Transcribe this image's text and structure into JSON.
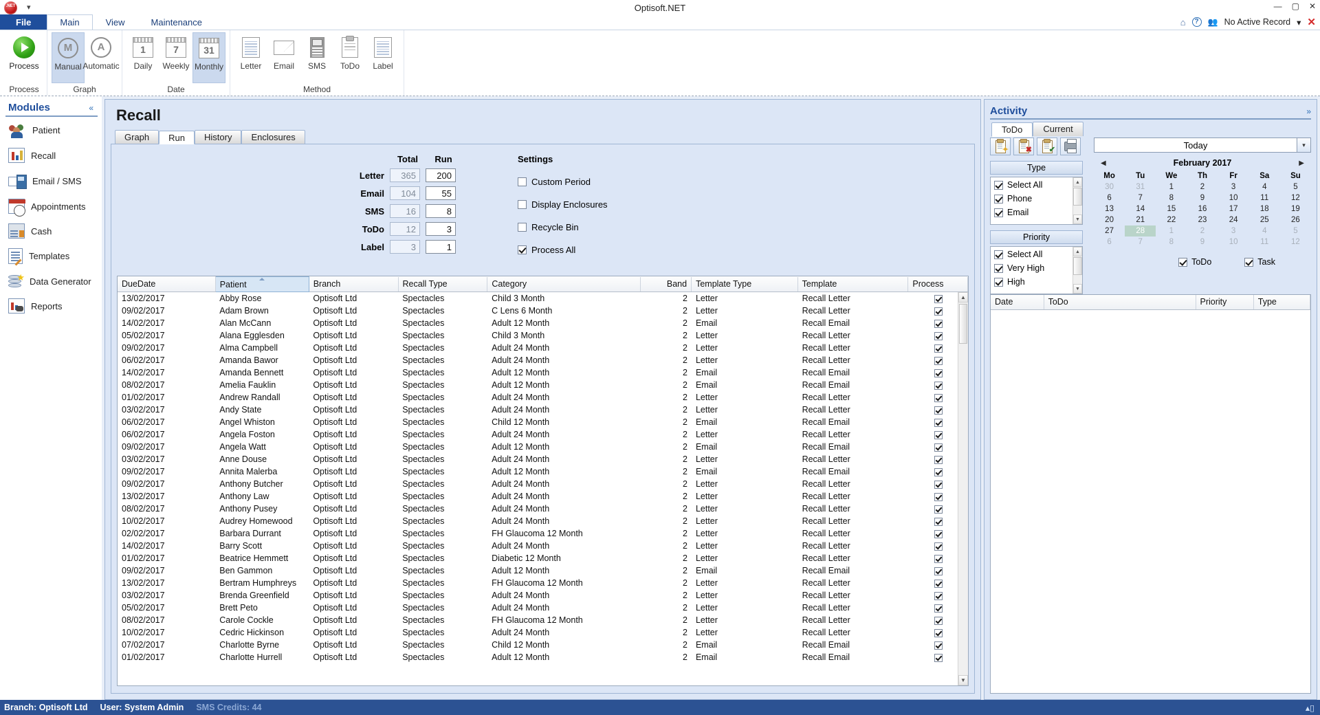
{
  "window": {
    "title": "Optisoft.NET",
    "minimize": "—",
    "maximize": "▢",
    "close": "✕",
    "qat_arrow": "▾"
  },
  "ribbon": {
    "tabs": [
      {
        "label": "File",
        "active": false,
        "kind": "file"
      },
      {
        "label": "Main",
        "active": true,
        "kind": "normal"
      },
      {
        "label": "View",
        "active": false,
        "kind": "normal"
      },
      {
        "label": "Maintenance",
        "active": false,
        "kind": "normal"
      }
    ],
    "right": {
      "record_label": "No Active Record",
      "record_caret": "▾",
      "help_glyph": "?",
      "home_glyph": "⌂",
      "close_glyph": "✕"
    },
    "groups": [
      {
        "label": "Process",
        "buttons": [
          {
            "label": "Process",
            "icon": "play-circle-icon",
            "selected": false,
            "enabled": true
          }
        ]
      },
      {
        "label": "Graph",
        "buttons": [
          {
            "label": "Manual",
            "icon": "manual-circle-icon",
            "selected": true,
            "enabled": false,
            "glyph": "M"
          },
          {
            "label": "Automatic",
            "icon": "automatic-circle-icon",
            "selected": false,
            "enabled": false,
            "glyph": "A"
          }
        ]
      },
      {
        "label": "Date",
        "buttons": [
          {
            "label": "Daily",
            "icon": "calendar-day-icon",
            "selected": false,
            "enabled": false,
            "glyph": "1"
          },
          {
            "label": "Weekly",
            "icon": "calendar-week-icon",
            "selected": false,
            "enabled": false,
            "glyph": "7"
          },
          {
            "label": "Monthly",
            "icon": "calendar-month-icon",
            "selected": true,
            "enabled": false,
            "glyph": "31"
          }
        ]
      },
      {
        "label": "Method",
        "buttons": [
          {
            "label": "Letter",
            "icon": "letter-icon",
            "selected": false,
            "enabled": false
          },
          {
            "label": "Email",
            "icon": "envelope-icon",
            "selected": false,
            "enabled": false
          },
          {
            "label": "SMS",
            "icon": "mobile-phone-icon",
            "selected": false,
            "enabled": false
          },
          {
            "label": "ToDo",
            "icon": "clipboard-icon",
            "selected": false,
            "enabled": false
          },
          {
            "label": "Label",
            "icon": "label-icon",
            "selected": false,
            "enabled": false
          }
        ]
      }
    ]
  },
  "sidebar": {
    "title": "Modules",
    "collapse_glyph": "«",
    "items": [
      {
        "label": "Patient",
        "icon": "patients-icon"
      },
      {
        "label": "Recall",
        "icon": "recall-chart-icon"
      },
      {
        "label": "Email / SMS",
        "icon": "email-sms-icon"
      },
      {
        "label": "Appointments",
        "icon": "appointments-icon"
      },
      {
        "label": "Cash",
        "icon": "cash-register-icon"
      },
      {
        "label": "Templates",
        "icon": "templates-icon"
      },
      {
        "label": "Data Generator",
        "icon": "data-generator-icon"
      },
      {
        "label": "Reports",
        "icon": "reports-icon"
      }
    ]
  },
  "main": {
    "title": "Recall",
    "tabs": [
      {
        "label": "Graph",
        "active": false
      },
      {
        "label": "Run",
        "active": true
      },
      {
        "label": "History",
        "active": false
      },
      {
        "label": "Enclosures",
        "active": false
      }
    ],
    "counts": {
      "header_total": "Total",
      "header_run": "Run",
      "rows": [
        {
          "label": "Letter",
          "total": "365",
          "run": "200"
        },
        {
          "label": "Email",
          "total": "104",
          "run": "55"
        },
        {
          "label": "SMS",
          "total": "16",
          "run": "8"
        },
        {
          "label": "ToDo",
          "total": "12",
          "run": "3"
        },
        {
          "label": "Label",
          "total": "3",
          "run": "1"
        }
      ]
    },
    "settings": {
      "title": "Settings",
      "options": [
        {
          "label": "Custom Period",
          "checked": false
        },
        {
          "label": "Display Enclosures",
          "checked": false
        },
        {
          "label": "Recycle Bin",
          "checked": false
        },
        {
          "label": "Process All",
          "checked": true
        }
      ]
    },
    "grid": {
      "columns": [
        {
          "label": "DueDate",
          "align": "left",
          "sorted": false
        },
        {
          "label": "Patient",
          "align": "left",
          "sorted": true
        },
        {
          "label": "Branch",
          "align": "left",
          "sorted": false
        },
        {
          "label": "Recall Type",
          "align": "left",
          "sorted": false
        },
        {
          "label": "Category",
          "align": "left",
          "sorted": false
        },
        {
          "label": "Band",
          "align": "right",
          "sorted": false
        },
        {
          "label": "Template Type",
          "align": "left",
          "sorted": false
        },
        {
          "label": "Template",
          "align": "left",
          "sorted": false
        },
        {
          "label": "Process",
          "align": "left",
          "sorted": false
        }
      ],
      "rows": [
        [
          "13/02/2017",
          "Abby Rose",
          "Optisoft Ltd",
          "Spectacles",
          "Child 3 Month",
          "2",
          "Letter",
          "Recall Letter",
          true
        ],
        [
          "09/02/2017",
          "Adam Brown",
          "Optisoft Ltd",
          "Spectacles",
          "C Lens 6 Month",
          "2",
          "Letter",
          "Recall Letter",
          true
        ],
        [
          "14/02/2017",
          "Alan McCann",
          "Optisoft Ltd",
          "Spectacles",
          "Adult 12 Month",
          "2",
          "Email",
          "Recall Email",
          true
        ],
        [
          "05/02/2017",
          "Alana Egglesden",
          "Optisoft Ltd",
          "Spectacles",
          "Child 3 Month",
          "2",
          "Letter",
          "Recall Letter",
          true
        ],
        [
          "09/02/2017",
          "Alma Campbell",
          "Optisoft Ltd",
          "Spectacles",
          "Adult 24 Month",
          "2",
          "Letter",
          "Recall Letter",
          true
        ],
        [
          "06/02/2017",
          "Amanda Bawor",
          "Optisoft Ltd",
          "Spectacles",
          "Adult 24 Month",
          "2",
          "Letter",
          "Recall Letter",
          true
        ],
        [
          "14/02/2017",
          "Amanda Bennett",
          "Optisoft Ltd",
          "Spectacles",
          "Adult 12 Month",
          "2",
          "Email",
          "Recall Email",
          true
        ],
        [
          "08/02/2017",
          "Amelia Fauklin",
          "Optisoft Ltd",
          "Spectacles",
          "Adult 12 Month",
          "2",
          "Email",
          "Recall Email",
          true
        ],
        [
          "01/02/2017",
          "Andrew Randall",
          "Optisoft Ltd",
          "Spectacles",
          "Adult 24 Month",
          "2",
          "Letter",
          "Recall Letter",
          true
        ],
        [
          "03/02/2017",
          "Andy State",
          "Optisoft Ltd",
          "Spectacles",
          "Adult 24 Month",
          "2",
          "Letter",
          "Recall Letter",
          true
        ],
        [
          "06/02/2017",
          "Angel Whiston",
          "Optisoft Ltd",
          "Spectacles",
          "Child 12 Month",
          "2",
          "Email",
          "Recall Email",
          true
        ],
        [
          "06/02/2017",
          "Angela Foston",
          "Optisoft Ltd",
          "Spectacles",
          "Adult 24 Month",
          "2",
          "Letter",
          "Recall Letter",
          true
        ],
        [
          "09/02/2017",
          "Angela Watt",
          "Optisoft Ltd",
          "Spectacles",
          "Adult 12 Month",
          "2",
          "Email",
          "Recall Email",
          true
        ],
        [
          "03/02/2017",
          "Anne Douse",
          "Optisoft Ltd",
          "Spectacles",
          "Adult 24 Month",
          "2",
          "Letter",
          "Recall Letter",
          true
        ],
        [
          "09/02/2017",
          "Annita Malerba",
          "Optisoft Ltd",
          "Spectacles",
          "Adult 12 Month",
          "2",
          "Email",
          "Recall Email",
          true
        ],
        [
          "09/02/2017",
          "Anthony Butcher",
          "Optisoft Ltd",
          "Spectacles",
          "Adult 24 Month",
          "2",
          "Letter",
          "Recall Letter",
          true
        ],
        [
          "13/02/2017",
          "Anthony Law",
          "Optisoft Ltd",
          "Spectacles",
          "Adult 24 Month",
          "2",
          "Letter",
          "Recall Letter",
          true
        ],
        [
          "08/02/2017",
          "Anthony Pusey",
          "Optisoft Ltd",
          "Spectacles",
          "Adult 24 Month",
          "2",
          "Letter",
          "Recall Letter",
          true
        ],
        [
          "10/02/2017",
          "Audrey Homewood",
          "Optisoft Ltd",
          "Spectacles",
          "Adult 24 Month",
          "2",
          "Letter",
          "Recall Letter",
          true
        ],
        [
          "02/02/2017",
          "Barbara Durrant",
          "Optisoft Ltd",
          "Spectacles",
          "FH Glaucoma 12 Month",
          "2",
          "Letter",
          "Recall Letter",
          true
        ],
        [
          "14/02/2017",
          "Barry Scott",
          "Optisoft Ltd",
          "Spectacles",
          "Adult 24 Month",
          "2",
          "Letter",
          "Recall Letter",
          true
        ],
        [
          "01/02/2017",
          "Beatrice Hemmett",
          "Optisoft Ltd",
          "Spectacles",
          "Diabetic 12 Month",
          "2",
          "Letter",
          "Recall Letter",
          true
        ],
        [
          "09/02/2017",
          "Ben Gammon",
          "Optisoft Ltd",
          "Spectacles",
          "Adult 12 Month",
          "2",
          "Email",
          "Recall Email",
          true
        ],
        [
          "13/02/2017",
          "Bertram Humphreys",
          "Optisoft Ltd",
          "Spectacles",
          "FH Glaucoma 12 Month",
          "2",
          "Letter",
          "Recall Letter",
          true
        ],
        [
          "03/02/2017",
          "Brenda Greenfield",
          "Optisoft Ltd",
          "Spectacles",
          "Adult 24 Month",
          "2",
          "Letter",
          "Recall Letter",
          true
        ],
        [
          "05/02/2017",
          "Brett Peto",
          "Optisoft Ltd",
          "Spectacles",
          "Adult 24 Month",
          "2",
          "Letter",
          "Recall Letter",
          true
        ],
        [
          "08/02/2017",
          "Carole Cockle",
          "Optisoft Ltd",
          "Spectacles",
          "FH Glaucoma 12 Month",
          "2",
          "Letter",
          "Recall Letter",
          true
        ],
        [
          "10/02/2017",
          "Cedric Hickinson",
          "Optisoft Ltd",
          "Spectacles",
          "Adult 24 Month",
          "2",
          "Letter",
          "Recall Letter",
          true
        ],
        [
          "07/02/2017",
          "Charlotte Byrne",
          "Optisoft Ltd",
          "Spectacles",
          "Child 12 Month",
          "2",
          "Email",
          "Recall Email",
          true
        ],
        [
          "01/02/2017",
          "Charlotte Hurrell",
          "Optisoft Ltd",
          "Spectacles",
          "Adult 12 Month",
          "2",
          "Email",
          "Recall Email",
          true
        ]
      ]
    }
  },
  "activity": {
    "title": "Activity",
    "expand_glyph": "»",
    "tabs": [
      {
        "label": "ToDo",
        "active": true
      },
      {
        "label": "Current",
        "active": false
      }
    ],
    "toolbar": [
      {
        "name": "new-todo-button",
        "icon": "clipboard-new-icon",
        "badge": "✦"
      },
      {
        "name": "delete-todo-button",
        "icon": "clipboard-delete-icon",
        "badge": "✖"
      },
      {
        "name": "complete-todo-button",
        "icon": "clipboard-complete-icon",
        "badge": "✔"
      },
      {
        "name": "print-todo-button",
        "icon": "printer-icon",
        "badge": ""
      }
    ],
    "filters": [
      {
        "title": "Type",
        "options": [
          {
            "label": "Select All",
            "checked": true
          },
          {
            "label": "Phone",
            "checked": true
          },
          {
            "label": "Email",
            "checked": true
          }
        ]
      },
      {
        "title": "Priority",
        "options": [
          {
            "label": "Select All",
            "checked": true
          },
          {
            "label": "Very High",
            "checked": true
          },
          {
            "label": "High",
            "checked": true
          }
        ]
      }
    ],
    "date_picker": {
      "today_label": "Today",
      "dropdown_glyph": "▾",
      "prev_glyph": "◀",
      "next_glyph": "▶",
      "month_label": "February 2017",
      "weekdays": [
        "Mo",
        "Tu",
        "We",
        "Th",
        "Fr",
        "Sa",
        "Su"
      ],
      "weeks": [
        [
          {
            "d": "30",
            "o": true
          },
          {
            "d": "31",
            "o": true
          },
          {
            "d": "1"
          },
          {
            "d": "2"
          },
          {
            "d": "3"
          },
          {
            "d": "4"
          },
          {
            "d": "5"
          }
        ],
        [
          {
            "d": "6"
          },
          {
            "d": "7"
          },
          {
            "d": "8"
          },
          {
            "d": "9"
          },
          {
            "d": "10"
          },
          {
            "d": "11"
          },
          {
            "d": "12"
          }
        ],
        [
          {
            "d": "13"
          },
          {
            "d": "14"
          },
          {
            "d": "15"
          },
          {
            "d": "16"
          },
          {
            "d": "17"
          },
          {
            "d": "18"
          },
          {
            "d": "19"
          }
        ],
        [
          {
            "d": "20"
          },
          {
            "d": "21"
          },
          {
            "d": "22"
          },
          {
            "d": "23"
          },
          {
            "d": "24"
          },
          {
            "d": "25"
          },
          {
            "d": "26"
          }
        ],
        [
          {
            "d": "27"
          },
          {
            "d": "28",
            "sel": true
          },
          {
            "d": "1",
            "o": true
          },
          {
            "d": "2",
            "o": true
          },
          {
            "d": "3",
            "o": true
          },
          {
            "d": "4",
            "o": true
          },
          {
            "d": "5",
            "o": true
          }
        ],
        [
          {
            "d": "6",
            "o": true
          },
          {
            "d": "7",
            "o": true
          },
          {
            "d": "8",
            "o": true
          },
          {
            "d": "9",
            "o": true
          },
          {
            "d": "10",
            "o": true
          },
          {
            "d": "11",
            "o": true
          },
          {
            "d": "12",
            "o": true
          }
        ]
      ]
    },
    "view_toggles": [
      {
        "label": "ToDo",
        "checked": true
      },
      {
        "label": "Task",
        "checked": true
      }
    ],
    "grid": {
      "columns": [
        "Date",
        "ToDo",
        "Priority",
        "Type"
      ],
      "rows": []
    }
  },
  "statusbar": {
    "branch": "Branch: Optisoft Ltd",
    "user": "User: System Admin",
    "sms_credits": "SMS Credits: 44",
    "right_glyph": "▴▯"
  },
  "colors": {
    "accent": "#1f4e9c",
    "panel_bg": "#dce6f6",
    "status_bg": "#2c5293",
    "file_tab": "#1f4e9c"
  }
}
